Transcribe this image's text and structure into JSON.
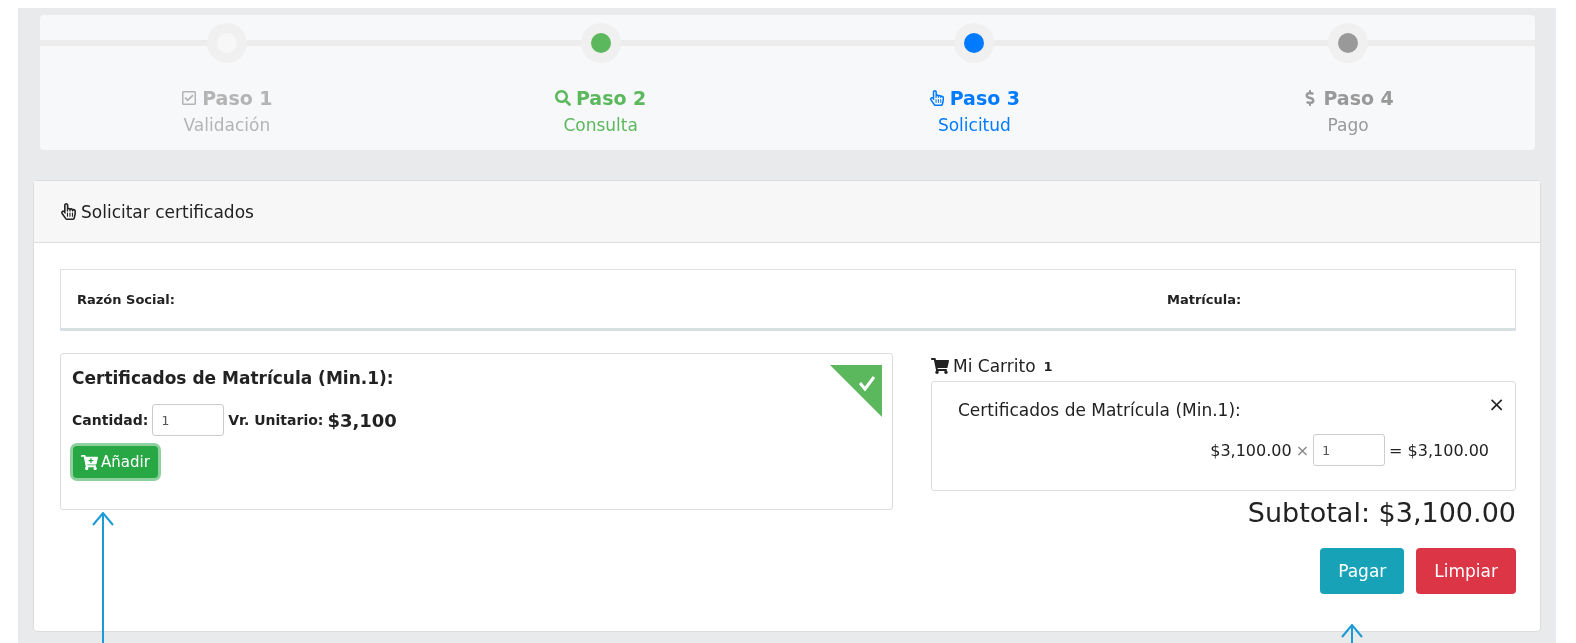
{
  "steps": [
    {
      "title": "Paso 1",
      "subtitle": "Validación",
      "done": true,
      "color": "#b4b4b4"
    },
    {
      "title": "Paso 2",
      "subtitle": "Consulta",
      "done": false,
      "color": "#5cb85c"
    },
    {
      "title": "Paso 3",
      "subtitle": "Solicitud",
      "done": false,
      "color": "#007bff"
    },
    {
      "title": "Paso 4",
      "subtitle": "Pago",
      "done": false,
      "color": "#999999"
    }
  ],
  "panel": {
    "title": "Solicitar certificados"
  },
  "info": {
    "fields": [
      {
        "label": "Razón Social:"
      },
      {
        "label": "Matrícula:"
      }
    ]
  },
  "product": {
    "title": "Certificados de Matrícula (Min.1):",
    "added": true,
    "quantity_label": "Cantidad:",
    "quantity": "1",
    "unit_label": "Vr. Unitario:",
    "unit_price": "$3,100",
    "add_button": "Añadir"
  },
  "cart": {
    "title": "Mi Carrito",
    "count": "1",
    "items": [
      {
        "name": "Certificados de Matrícula (Min.1):",
        "price": "$3,100.00",
        "times": "×",
        "quantity": "1",
        "total": "= $3,100.00",
        "remove": "×"
      }
    ],
    "subtotal": "Subtotal: $3,100.00",
    "buttons": [
      {
        "label": "Pagar",
        "kind": "primary"
      },
      {
        "label": "Limpiar",
        "kind": "danger"
      }
    ]
  },
  "annotations": [
    {
      "kind": "arrow"
    },
    {
      "kind": "arrow"
    }
  ]
}
